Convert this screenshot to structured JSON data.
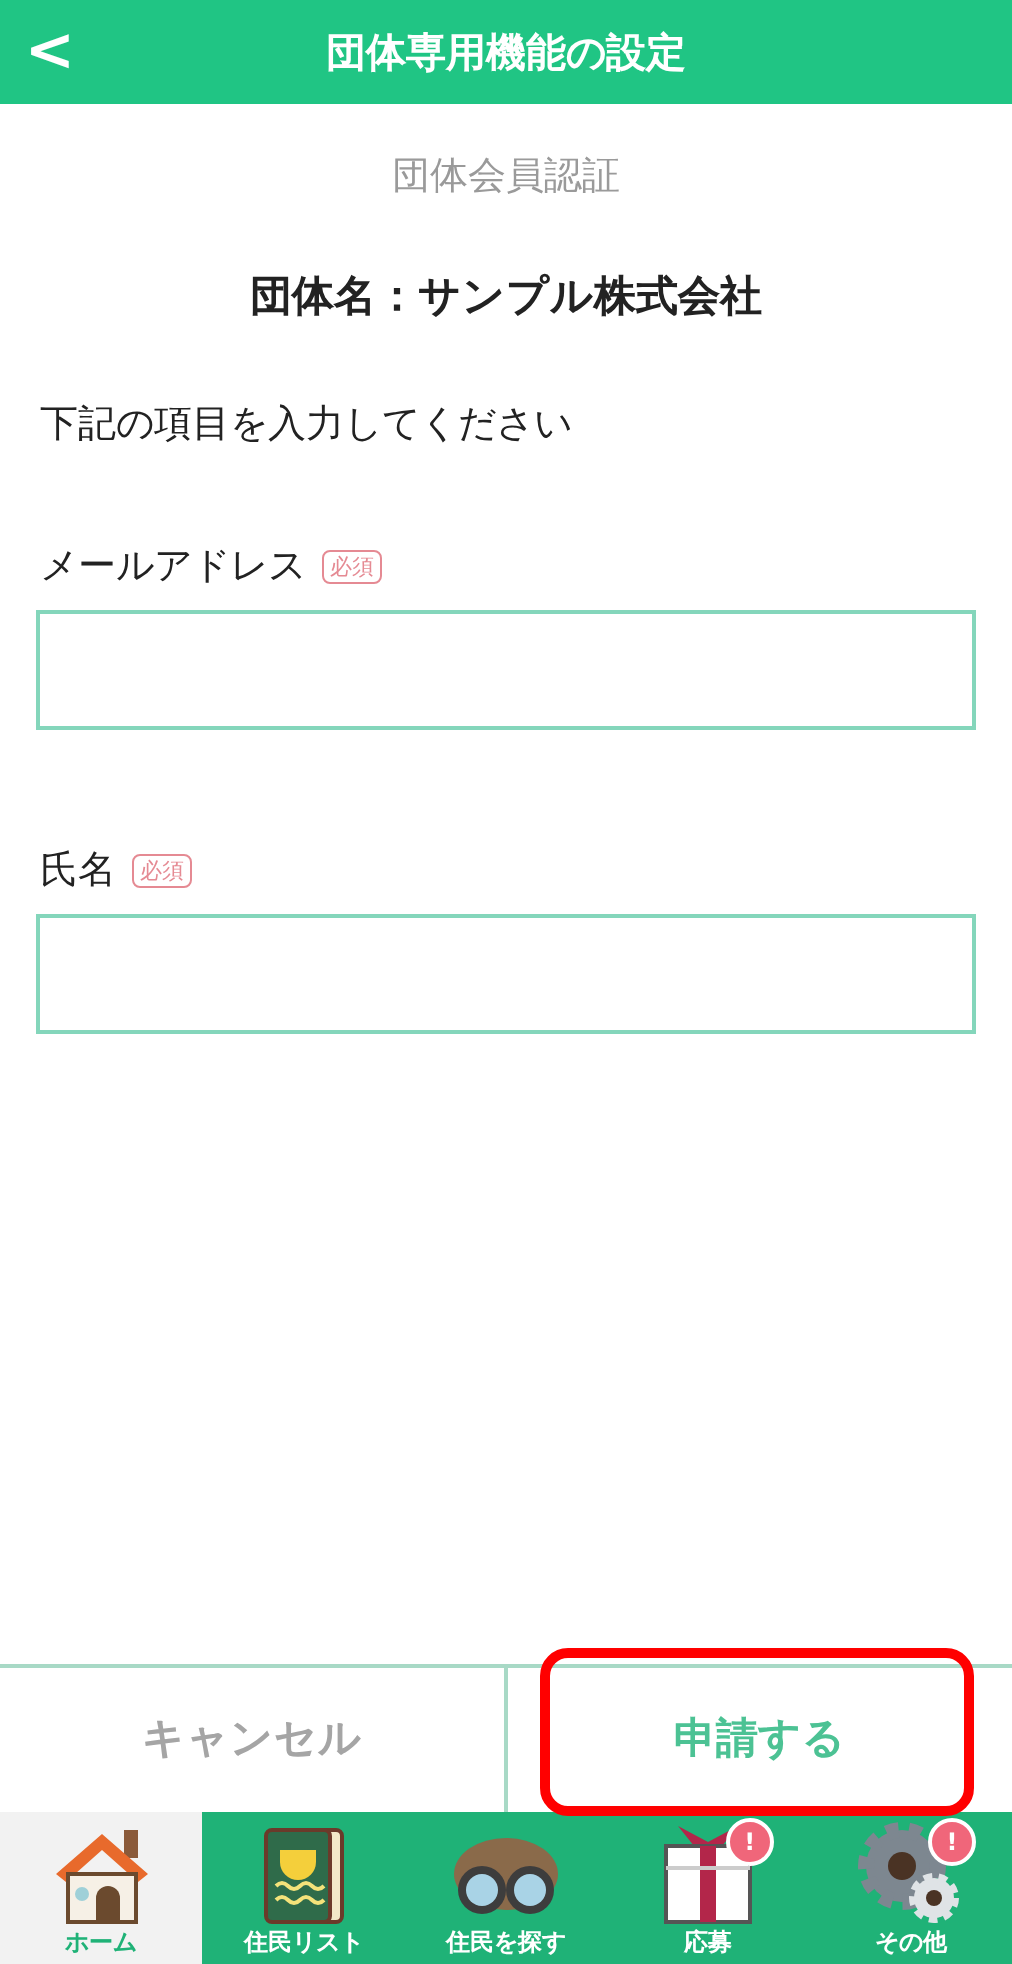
{
  "header": {
    "back": "<",
    "title": "団体専用機能の設定"
  },
  "subtitle": "団体会員認証",
  "organization": "団体名：サンプル株式会社",
  "instruction": "下記の項目を入力してください",
  "fields": [
    {
      "label": "メールアドレス",
      "required_badge": "必須"
    },
    {
      "label": "氏名",
      "required_badge": "必須"
    }
  ],
  "actions": [
    {
      "label": "キャンセル",
      "kind": "cancel",
      "highlighted": false
    },
    {
      "label": "申請する",
      "kind": "submit",
      "highlighted": true
    }
  ],
  "tabs": [
    {
      "label": "ホーム",
      "kind": "house",
      "selected": true
    },
    {
      "label": "住民リスト",
      "kind": "book",
      "selected": false
    },
    {
      "label": "住民を探す",
      "kind": "binoculars",
      "selected": false
    },
    {
      "label": "応募",
      "kind": "gift",
      "selected": false,
      "badge": "!"
    },
    {
      "label": "その他",
      "kind": "gear",
      "selected": false,
      "badge": "!"
    }
  ]
}
